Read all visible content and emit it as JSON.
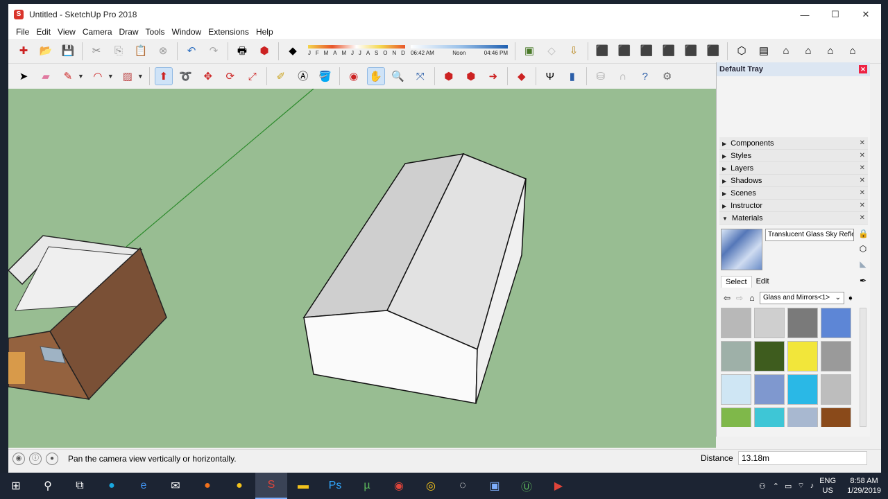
{
  "window": {
    "title": "Untitled - SketchUp Pro 2018",
    "min": "—",
    "max": "☐",
    "close": "✕"
  },
  "menu": [
    "File",
    "Edit",
    "View",
    "Camera",
    "Draw",
    "Tools",
    "Window",
    "Extensions",
    "Help"
  ],
  "shadows": {
    "months": [
      "J",
      "F",
      "M",
      "A",
      "M",
      "J",
      "J",
      "A",
      "S",
      "O",
      "N",
      "D"
    ],
    "time_start": "06:42 AM",
    "time_mid": "Noon",
    "time_end": "04:46 PM"
  },
  "tray": {
    "title": "Default Tray",
    "panels": [
      {
        "label": "Components",
        "icon": "triangle-right"
      },
      {
        "label": "Styles",
        "icon": "triangle-right"
      },
      {
        "label": "Layers",
        "icon": "triangle-right"
      },
      {
        "label": "Shadows",
        "icon": "triangle-right"
      },
      {
        "label": "Scenes",
        "icon": "triangle-right"
      },
      {
        "label": "Instructor",
        "icon": "triangle-right"
      },
      {
        "label": "Materials",
        "icon": "triangle-down"
      }
    ],
    "materials": {
      "name": "Translucent Glass Sky Refle",
      "tab_select": "Select",
      "tab_edit": "Edit",
      "library": "Glass and Mirrors<1>",
      "swatches": [
        "#b8b8b8",
        "#cfcfcf",
        "#7a7a7a",
        "#5d86d6",
        "#9eb0a8",
        "#3e5c1e",
        "#f2e63a",
        "#9a9a9a",
        "#cfe6f4",
        "#7f98cf",
        "#2ab8e6",
        "#bdbdbd",
        "#7fb84a",
        "#3ec6d6",
        "#a8b8d0",
        "#8a4a1a"
      ]
    }
  },
  "status": {
    "hint": "Pan the camera view vertically or horizontally.",
    "distance_label": "Distance",
    "distance_value": "13.18m"
  },
  "taskbar": {
    "lang1": "ENG",
    "lang2": "US",
    "time": "8:58 AM",
    "date": "1/29/2019"
  },
  "colors": {
    "sky_ground": "#98bd92",
    "accent": "#1e5fb0"
  }
}
